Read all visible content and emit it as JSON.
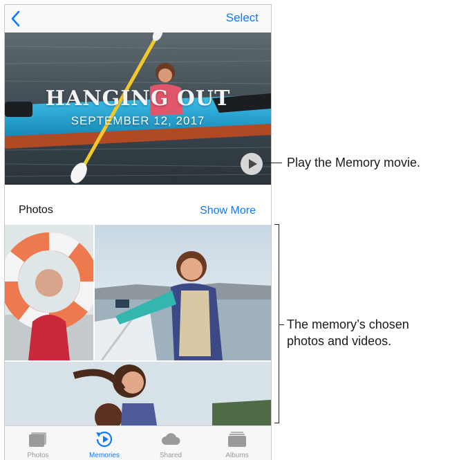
{
  "navbar": {
    "select_label": "Select"
  },
  "memory": {
    "title": "HANGING OUT",
    "date": "SEPTEMBER 12, 2017"
  },
  "section": {
    "title": "Photos",
    "show_more": "Show More"
  },
  "tabs": [
    {
      "label": "Photos",
      "icon": "photos-icon",
      "active": false
    },
    {
      "label": "Memories",
      "icon": "memories-icon",
      "active": true
    },
    {
      "label": "Shared",
      "icon": "cloud-icon",
      "active": false
    },
    {
      "label": "Albums",
      "icon": "albums-icon",
      "active": false
    }
  ],
  "callouts": {
    "play": "Play the Memory movie.",
    "photos_line1": "The memory’s chosen",
    "photos_line2": "photos and videos."
  },
  "colors": {
    "accent": "#0a7aff",
    "kayak": "#1aa6d6"
  }
}
